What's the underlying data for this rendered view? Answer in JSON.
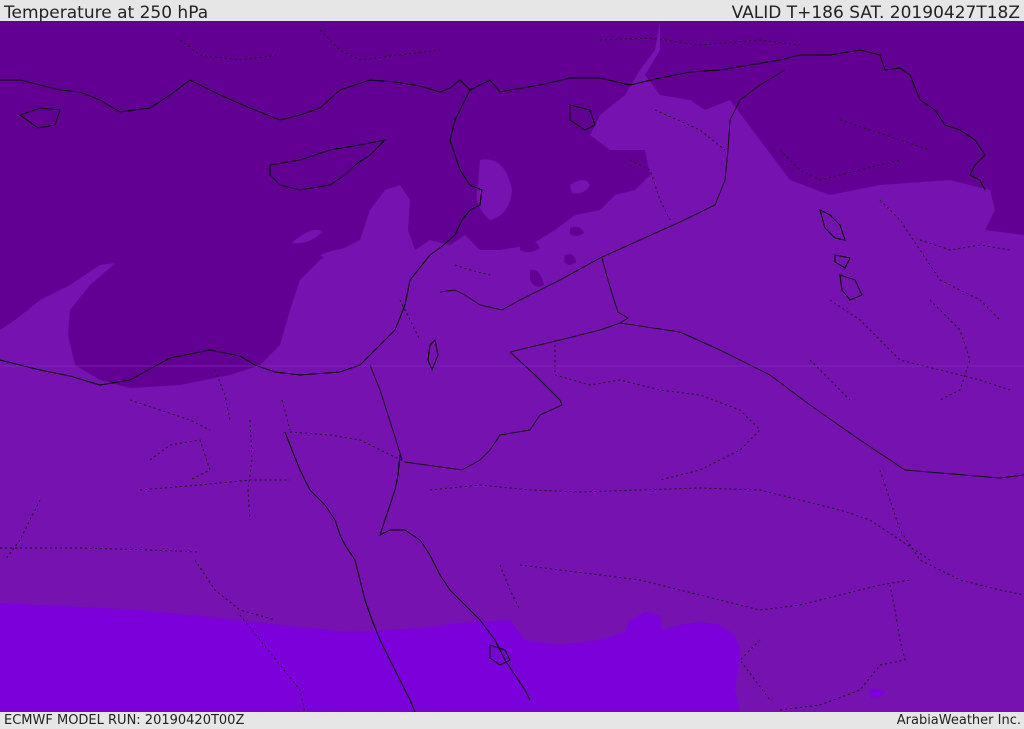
{
  "header": {
    "title": "Temperature at 250 hPa",
    "valid": "VALID T+186 SAT. 20190427T18Z"
  },
  "footer": {
    "model_run": "ECMWF MODEL RUN: 20190420T00Z",
    "credit": "ArabiaWeather Inc."
  },
  "map": {
    "colors": {
      "cold_band": "#630094",
      "mid_band": "#7512b0",
      "warm_band": "#7b00d9",
      "coastline": "#000000",
      "borders": "#111111"
    }
  }
}
